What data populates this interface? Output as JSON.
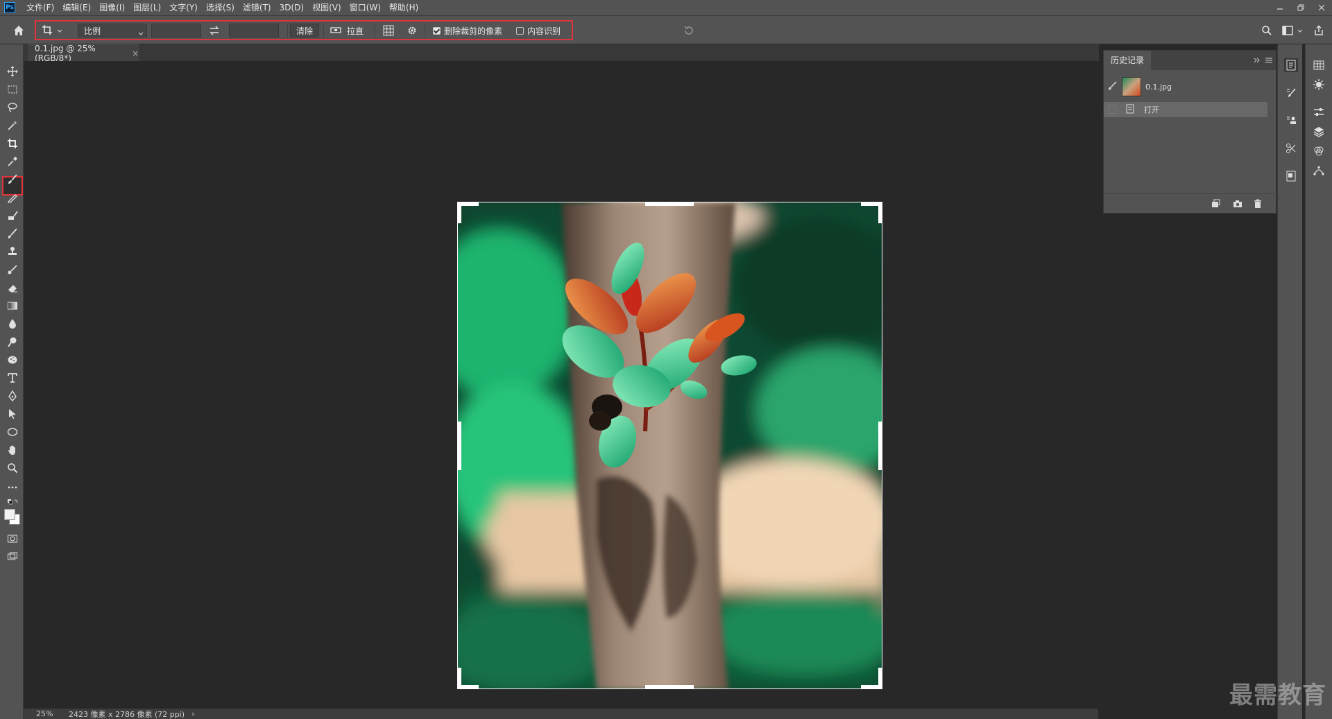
{
  "menubar": {
    "items": [
      "文件(F)",
      "编辑(E)",
      "图像(I)",
      "图层(L)",
      "文字(Y)",
      "选择(S)",
      "滤镜(T)",
      "3D(D)",
      "视图(V)",
      "窗口(W)",
      "帮助(H)"
    ],
    "app_icon": "Ps"
  },
  "options": {
    "ratio_label": "比例",
    "width_value": "",
    "height_value": "",
    "clear_label": "清除",
    "straighten_label": "拉直",
    "delete_cropped_label": "删除裁剪的像素",
    "delete_cropped_checked": true,
    "content_aware_label": "内容识别",
    "content_aware_checked": false
  },
  "document": {
    "tab_title": "0.1.jpg @ 25%(RGB/8*)",
    "close_symbol": "×"
  },
  "status": {
    "zoom": "25%",
    "info": "2423 像素 x 2786 像素 (72 ppi)",
    "arrow": "›"
  },
  "history": {
    "tab_label": "历史记录",
    "snapshot_name": "0.1.jpg",
    "steps": [
      "打开"
    ]
  },
  "watermark": "最需教育",
  "colors": {
    "crop_highlight": "#e0343a",
    "ui_bg": "#535353",
    "canvas_bg": "#282828"
  },
  "icons": {
    "toolbar": [
      "move-icon",
      "marquee-icon",
      "lasso-icon",
      "magic-wand-icon",
      "crop-icon",
      "eyedropper-icon",
      "brush-icon",
      "pencil-icon",
      "clone-stamp-icon",
      "history-brush-icon",
      "stamp-icon",
      "eraser-icon",
      "gradient-icon",
      "blur-icon",
      "dodge-icon",
      "sponge-icon",
      "text-icon",
      "pen-icon",
      "path-select-icon",
      "ellipse-icon",
      "hand-icon",
      "zoom-icon",
      "more-icon"
    ]
  }
}
